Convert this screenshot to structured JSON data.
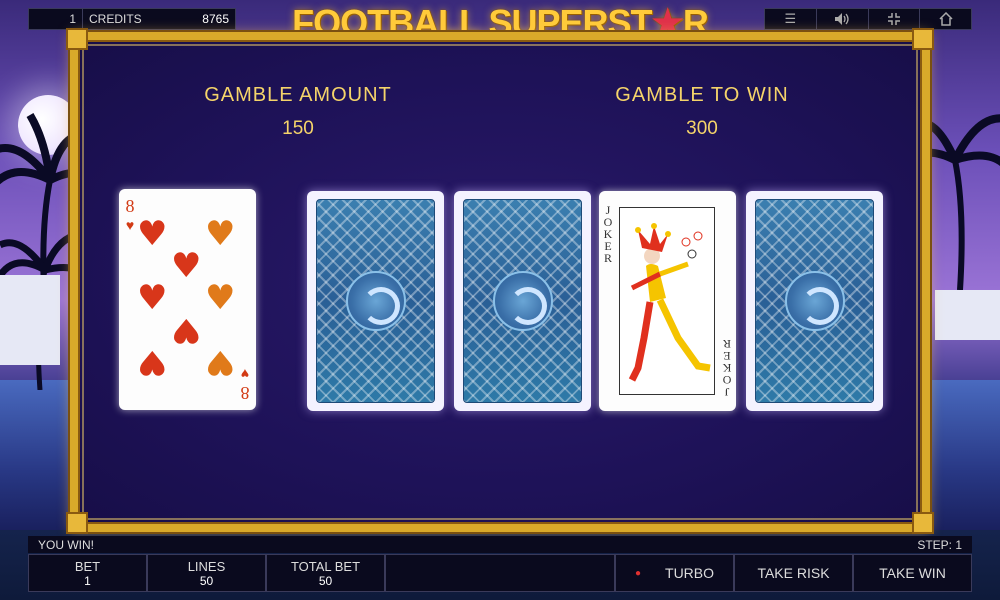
{
  "topbar": {
    "line_number": "1",
    "credits_label": "CREDITS",
    "credits_value": "8765",
    "icons": [
      "menu-icon",
      "sound-icon",
      "fullscreen-exit-icon",
      "home-icon"
    ]
  },
  "logo": {
    "text_main": "FOOTBALL SUPERST",
    "text_star": "★",
    "text_end": "R"
  },
  "gamble": {
    "amount_label": "GAMBLE AMOUNT",
    "amount_value": "150",
    "win_label": "GAMBLE TO WIN",
    "win_value": "300"
  },
  "cards": {
    "dealer": {
      "rank": "8",
      "suit": "hearts"
    },
    "choices": [
      "back",
      "back",
      "joker",
      "back"
    ],
    "joker_label": "JOKER"
  },
  "status": {
    "message": "YOU WIN!",
    "step": "STEP: 1"
  },
  "controls": {
    "bet_label": "BET",
    "bet_value": "1",
    "lines_label": "LINES",
    "lines_value": "50",
    "total_bet_label": "TOTAL BET",
    "total_bet_value": "50",
    "turbo_label": "TURBO",
    "take_risk_label": "TAKE RISK",
    "take_win_label": "TAKE WIN"
  },
  "colors": {
    "gold": "#d9a92a",
    "label_gold": "#f5d46a",
    "heart_red": "#d23a14",
    "panel_dark": "#0a0a1e"
  }
}
